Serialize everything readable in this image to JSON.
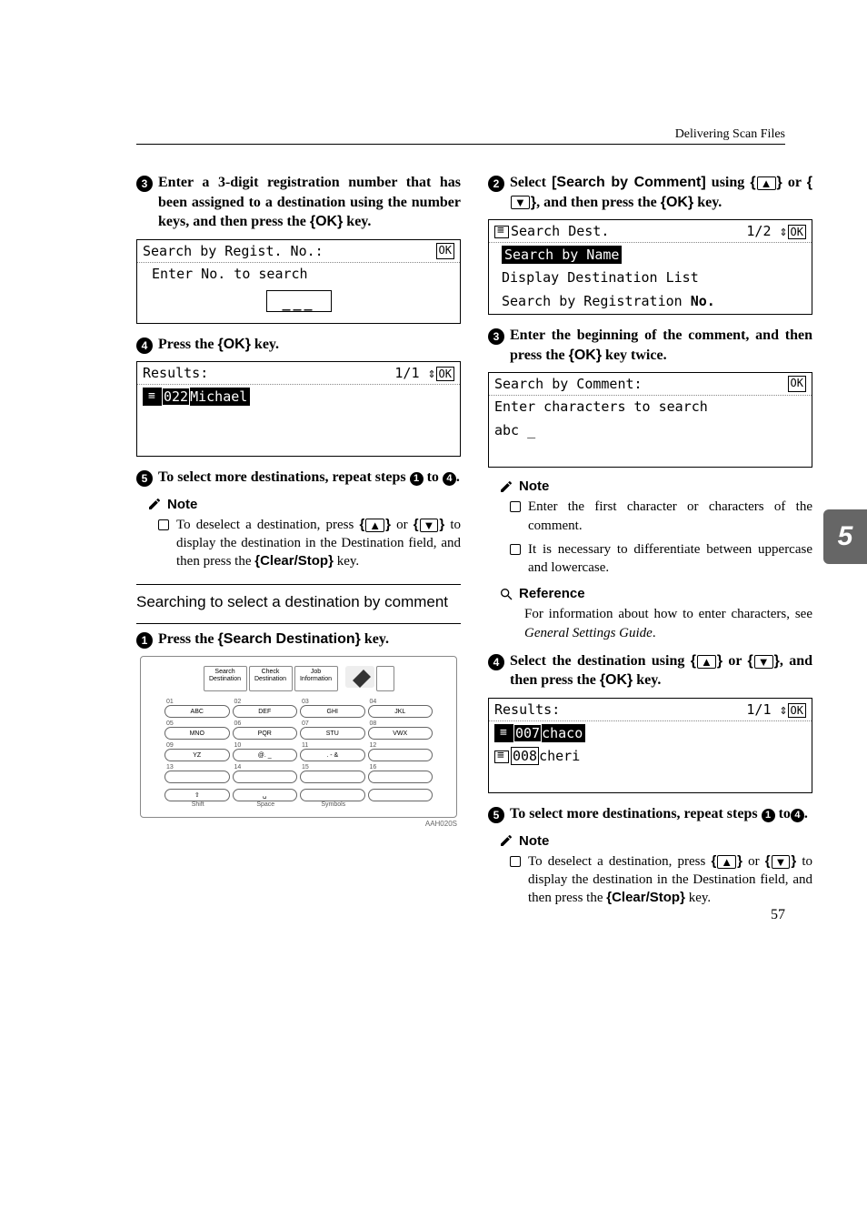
{
  "header": {
    "section": "Delivering Scan Files"
  },
  "page_number": "57",
  "side_tab": "5",
  "left": {
    "step3": {
      "num": "3",
      "text_a": "Enter a 3-digit registration number that has been assigned to a destination using the number keys, and then press the ",
      "key": "{OK}",
      "text_b": " key."
    },
    "lcd1": {
      "title": "Search by Regist. No.:",
      "ok": "OK",
      "row1": "Enter No. to search",
      "input": "___"
    },
    "step4": {
      "num": "4",
      "text_a": "Press the ",
      "key": "{OK}",
      "text_b": " key."
    },
    "lcd2": {
      "title": "Results:",
      "pager": "1/1",
      "ok": "OK",
      "item_prefix": "022",
      "item_text": "Michael"
    },
    "step5": {
      "num": "5",
      "text_a": "To select more destinations, repeat steps ",
      "ref1": "1",
      "text_b": " to ",
      "ref2": "4",
      "text_c": "."
    },
    "note_label": "Note",
    "note_text_a": "To deselect a destination, press ",
    "note_key_up": "▲",
    "note_text_or": " or ",
    "note_key_down": "▼",
    "note_text_b": " to display the destination in the Destination field, and then press the ",
    "note_key_clear": "{Clear/Stop}",
    "note_text_c": " key.",
    "subheading": "Searching to select a destination by comment",
    "stepA": {
      "num": "1",
      "text_a": "Press the ",
      "key": "{Search Destination}",
      "text_b": " key."
    },
    "keypad": {
      "soft1a": "Search",
      "soft1b": "Destination",
      "soft2a": "Check",
      "soft2b": "Destination",
      "soft3a": "Job",
      "soft3b": "Information",
      "rows": [
        [
          "01",
          "02",
          "03",
          "04",
          "ABC",
          "DEF",
          "GHI",
          "JKL"
        ],
        [
          "05",
          "06",
          "07",
          "08",
          "MNO",
          "PQR",
          "STU",
          "VWX"
        ],
        [
          "09",
          "10",
          "11",
          "12",
          "YZ",
          "@. _",
          ". - &",
          ""
        ],
        [
          "13",
          "14",
          "15",
          "16",
          "",
          "",
          "",
          ""
        ]
      ],
      "bottom": [
        "Shift",
        "Space",
        "Symbols"
      ],
      "caption": "AAH020S"
    }
  },
  "right": {
    "step2": {
      "num": "2",
      "text_a": "Select ",
      "bold": "[Search by Comment]",
      "text_b": " using ",
      "key_up": "▲",
      "text_or": " or ",
      "key_down": "▼",
      "text_c": ", and then press the ",
      "key_ok": "{OK}",
      "text_d": " key."
    },
    "lcd1": {
      "title": "Search Dest.",
      "pager": "1/2",
      "ok": "OK",
      "row1": "Search by Name",
      "row2": "Display Destination List",
      "row3_a": "Search by Registration ",
      "row3_b": "No."
    },
    "step3": {
      "num": "3",
      "text_a": "Enter the beginning of the comment, and then press the ",
      "key": "{OK}",
      "text_b": " key twice."
    },
    "lcd2": {
      "title": "Search by Comment:",
      "ok": "OK",
      "row1": "Enter characters to search",
      "row2": "abc  _"
    },
    "note_label": "Note",
    "note1": "Enter the first character or characters of the comment.",
    "note2": "It is necessary to differentiate between uppercase and lowercase.",
    "ref_label": "Reference",
    "ref_text_a": "For information about how to enter characters, see ",
    "ref_italic": "General Settings Guide",
    "ref_text_b": ".",
    "step4": {
      "num": "4",
      "text_a": "Select the destination using ",
      "key_up": "▲",
      "text_or": " or ",
      "key_down": "▼",
      "text_b": ", and then press the ",
      "key_ok": "{OK}",
      "text_c": " key."
    },
    "lcd3": {
      "title": "Results:",
      "pager": "1/1",
      "ok": "OK",
      "item1_prefix": "007",
      "item1_text": "chaco",
      "item2_prefix": "008",
      "item2_text": "cheri"
    },
    "step5": {
      "num": "5",
      "text_a": "To select more destinations, repeat steps ",
      "ref1": "1",
      "text_b": " to",
      "ref2": "4",
      "text_c": "."
    },
    "note2_label": "Note",
    "note2_text_a": "To deselect a destination, press ",
    "note2_key_up": "▲",
    "note2_text_or": " or ",
    "note2_key_down": "▼",
    "note2_text_b": " to display the destination in the Destination field, and then press the ",
    "note2_key_clear": "{Clear/Stop}",
    "note2_text_c": " key."
  }
}
